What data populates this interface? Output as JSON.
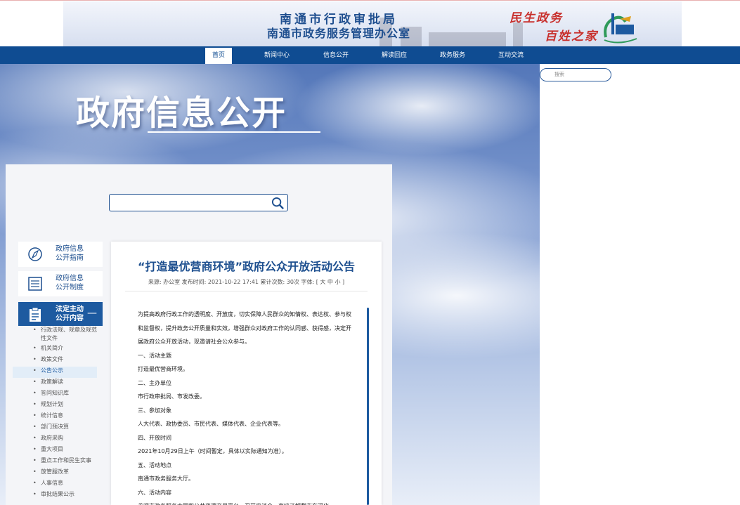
{
  "header": {
    "title_line1": "南通市行政审批局",
    "title_line2": "南通市政务服务管理办公室",
    "slogan1": "民生政务",
    "slogan2": "百姓之家",
    "logo_icon": "nantong-logo-icon"
  },
  "nav": {
    "items": [
      "首页",
      "新闻中心",
      "信息公开",
      "解读回应",
      "政务服务",
      "互动交流"
    ],
    "active_index": 0
  },
  "hero": {
    "title": "政府信息公开"
  },
  "side_search": {
    "placeholder": "搜索"
  },
  "panel_search": {
    "icon": "search-icon"
  },
  "menu": {
    "cards": [
      {
        "label_line1": "政府信息",
        "label_line2": "公开指南",
        "icon": "compass-icon"
      },
      {
        "label_line1": "政府信息",
        "label_line2": "公开制度",
        "icon": "list-icon"
      },
      {
        "label_line1": "法定主动",
        "label_line2": "公开内容",
        "icon": "clipboard-icon",
        "toggle": "—"
      }
    ],
    "sub_items": [
      "行政法规、规章及规范性文件",
      "机关简介",
      "政策文件",
      "公告公示",
      "政策解读",
      "答问知识库",
      "规划计划",
      "统计信息",
      "部门预决算",
      "政府采购",
      "重大项目",
      "重点工作和民生实事",
      "放管服改革",
      "人事信息",
      "审批结果公示"
    ],
    "active_sub": "公告公示"
  },
  "article": {
    "title": "“打造最优营商环境”政府公众开放活动公告",
    "meta": "来源: 办公室   发布时间: 2021-10-22 17:41   累计次数:   30次   字体: [ 大 中 小 ]",
    "paragraphs": [
      "为提高政府行政工作的透明度、开放度，切实保障人民群众的知情权、表达权、参与权和监督权，提升政务公开质量和实效，增强群众对政府工作的认同感、获得感，决定开展政府公众开放活动，现邀请社会公众参与。",
      "一、活动主题",
      "打造最优营商环境。",
      "二、主办单位",
      "市行政审批局、市发改委。",
      "三、参加对象",
      "人大代表、政协委员、市民代表、媒体代表、企业代表等。",
      "四、开放时间",
      "2021年10月29日上午（时间暂定，具体以实际通知为准）。",
      "五、活动地点",
      "南通市政务服务大厅。",
      "六、活动内容",
      "参观市政务服务大厅和公共资源交易平台，召开座谈会，直接了解我市在深化"
    ]
  },
  "colors": {
    "nav_bg": "#0f4c92",
    "accent": "#1d5aa0",
    "slogan": "#c8302d"
  }
}
